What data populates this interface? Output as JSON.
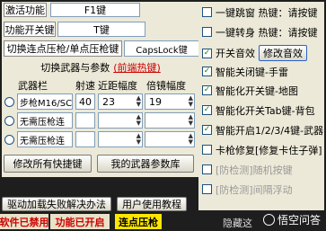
{
  "left": {
    "fn_label": "激活功能",
    "fn_key": "F1键",
    "switch_label": "功能开关键",
    "switch_key": "T键",
    "toggle_press_label": "切换连点压枪/单点压枪键",
    "toggle_press_key": "CapsLock键",
    "weapon_param_title": "切换武器与参数",
    "weapon_param_hint": "(前端热键)",
    "col_weapon": "武器栏",
    "col_speed": "射速",
    "col_near": "近距幅度",
    "col_multi": "倍镜幅度",
    "rows": [
      {
        "name": "步枪M16/SC",
        "speed": "40",
        "near": "23",
        "multi": "19"
      },
      {
        "name": "无需压枪连",
        "speed": "",
        "near": "",
        "multi": ""
      },
      {
        "name": "无需压枪连",
        "speed": "",
        "near": "",
        "multi": ""
      }
    ],
    "edit_hotkeys": "修改所有快捷键",
    "my_weapons": "我的武器参数库"
  },
  "bottom": {
    "driver_fail": "驱动加载失败解决办法",
    "user_manual": "用户使用教程",
    "status_disabled": "软件已禁用",
    "status_enabled": "功能已开启",
    "status_rapid": "连点压枪",
    "hidden": "隐藏这",
    "watermark": "悟空问答"
  },
  "right": {
    "items": [
      {
        "text": "一键跳窗 热键：请按键",
        "checked": false,
        "dim": false
      },
      {
        "text": "一键转身 热键：请按键",
        "checked": false,
        "dim": false
      },
      {
        "text": "开关音效",
        "checked": true,
        "dim": false,
        "button": "修改音效"
      },
      {
        "text": "智能关闭键-手雷",
        "checked": true,
        "dim": false
      },
      {
        "text": "智能化开关键-地图",
        "checked": true,
        "dim": false
      },
      {
        "text": "智能化开关Tab键-背包",
        "checked": true,
        "dim": false
      },
      {
        "text": "智能开启1/2/3/4键-武器",
        "checked": true,
        "dim": false
      },
      {
        "text": "卡枪修复[修复卡住子弹]",
        "checked": false,
        "dim": false
      },
      {
        "text": "[防检测]随机按键",
        "checked": false,
        "dim": true
      },
      {
        "text": "[防检测]间隔浮动",
        "checked": false,
        "dim": true
      }
    ]
  }
}
